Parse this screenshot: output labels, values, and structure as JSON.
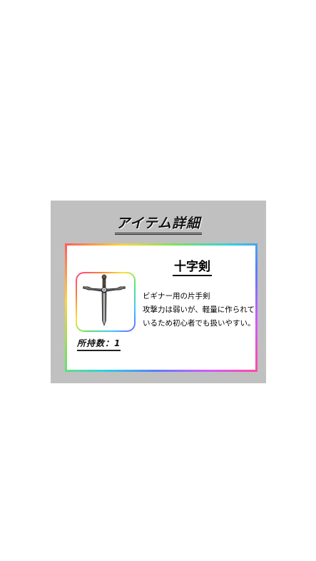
{
  "panel": {
    "title": "アイテム詳細"
  },
  "item": {
    "name": "十字剣",
    "icon": "sword-icon",
    "description_lines": [
      "ビギナー用の片手剣",
      "攻撃力は弱いが、軽量に作られて",
      "いるため初心者でも扱いやすい。"
    ],
    "count_label": "所持数：1"
  },
  "colors": {
    "panel_background": "#c0c0c0",
    "card_background": "#ffffff",
    "page_background": "#ffffff"
  }
}
